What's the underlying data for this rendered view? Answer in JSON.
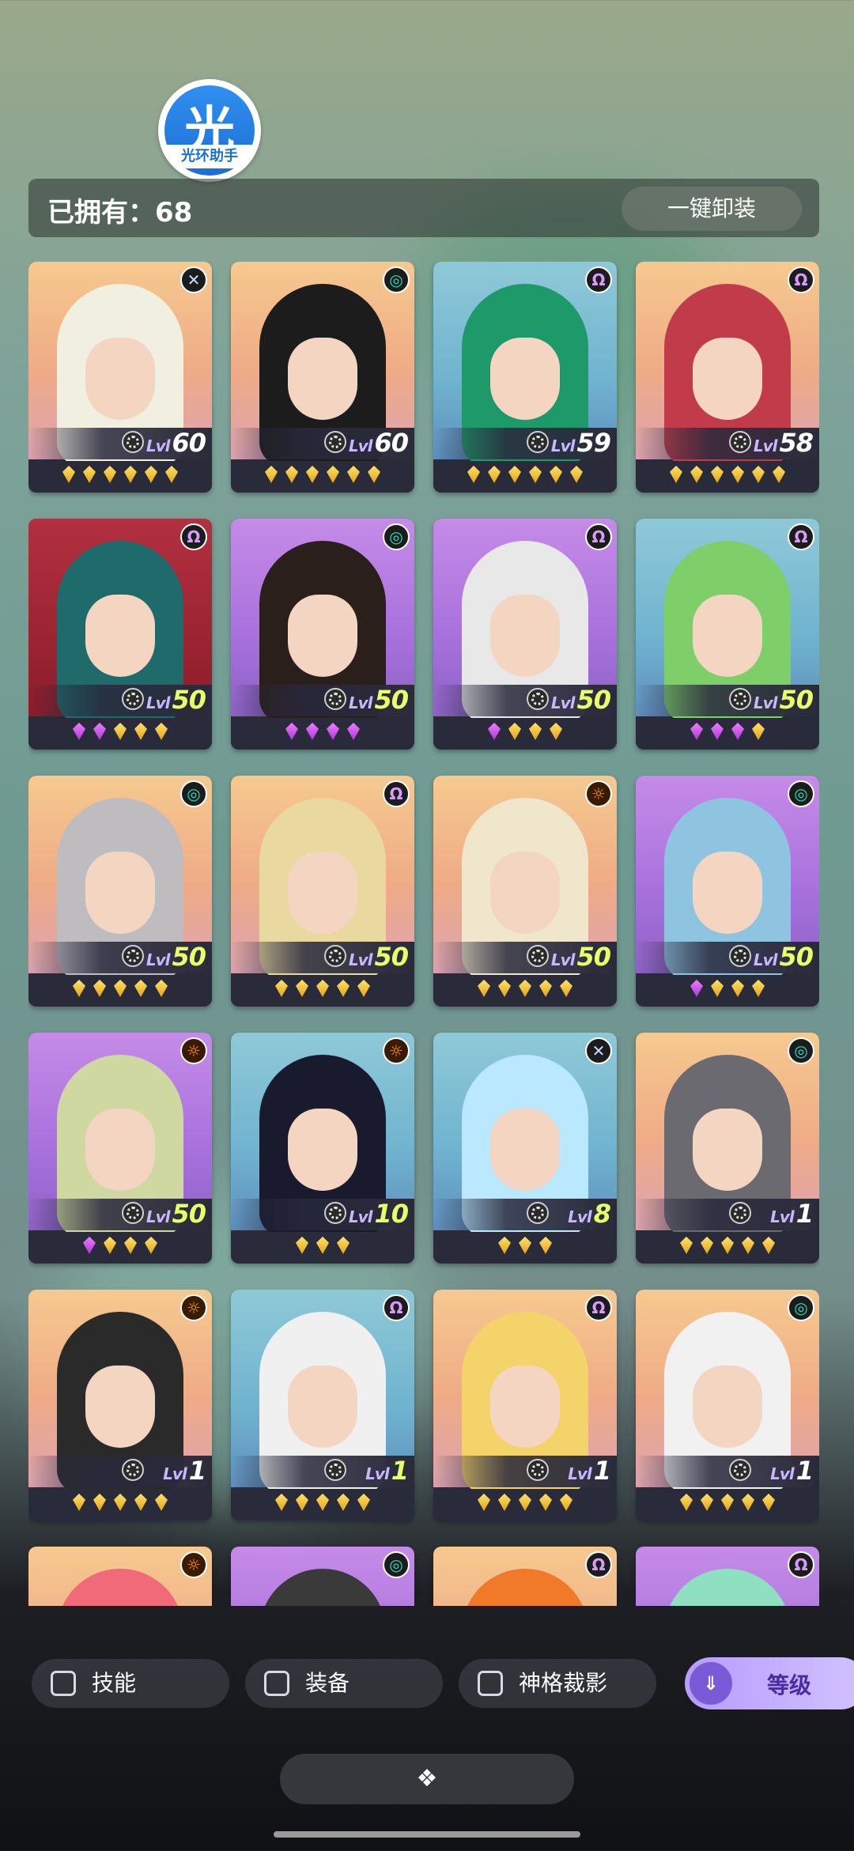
{
  "logo": {
    "glyph": "光",
    "caption": "光环助手"
  },
  "header": {
    "owned_label": "已拥有：68",
    "unequip_button": "一键卸装"
  },
  "heroes": [
    {
      "level": "60",
      "element": "x",
      "bg": "orange",
      "stars": [
        "g",
        "g",
        "g",
        "g",
        "g",
        "g"
      ]
    },
    {
      "level": "60",
      "element": "o",
      "bg": "orange",
      "stars": [
        "g",
        "g",
        "g",
        "g",
        "g",
        "g"
      ]
    },
    {
      "level": "59",
      "element": "w",
      "bg": "blue",
      "stars": [
        "g",
        "g",
        "g",
        "g",
        "g",
        "g"
      ]
    },
    {
      "level": "58",
      "element": "w",
      "bg": "orange",
      "stars": [
        "g",
        "g",
        "g",
        "g",
        "g",
        "g"
      ]
    },
    {
      "level": "50",
      "element": "w",
      "bg": "red",
      "stars": [
        "p",
        "p",
        "g",
        "g",
        "g"
      ]
    },
    {
      "level": "50",
      "element": "o",
      "bg": "purple",
      "stars": [
        "p",
        "p",
        "p",
        "p"
      ]
    },
    {
      "level": "50",
      "element": "w",
      "bg": "purple",
      "stars": [
        "p",
        "g",
        "g",
        "g"
      ]
    },
    {
      "level": "50",
      "element": "w",
      "bg": "blue",
      "stars": [
        "p",
        "p",
        "p",
        "g"
      ]
    },
    {
      "level": "50",
      "element": "o",
      "bg": "orange",
      "stars": [
        "g",
        "g",
        "g",
        "g",
        "g"
      ]
    },
    {
      "level": "50",
      "element": "w",
      "bg": "orange",
      "stars": [
        "g",
        "g",
        "g",
        "g",
        "g"
      ]
    },
    {
      "level": "50",
      "element": "s",
      "bg": "orange",
      "stars": [
        "g",
        "g",
        "g",
        "g",
        "g"
      ]
    },
    {
      "level": "50",
      "element": "o",
      "bg": "purple",
      "stars": [
        "p",
        "g",
        "g",
        "g"
      ]
    },
    {
      "level": "50",
      "element": "s",
      "bg": "purple",
      "stars": [
        "p",
        "g",
        "g",
        "g"
      ]
    },
    {
      "level": "10",
      "element": "s",
      "bg": "blue",
      "stars": [
        "g",
        "g",
        "g"
      ]
    },
    {
      "level": "8",
      "element": "x",
      "bg": "blue",
      "stars": [
        "g",
        "g",
        "g"
      ]
    },
    {
      "level": "1",
      "element": "o",
      "bg": "orange",
      "stars": [
        "g",
        "g",
        "g",
        "g",
        "g"
      ]
    },
    {
      "level": "1",
      "element": "s",
      "bg": "orange",
      "stars": [
        "g",
        "g",
        "g",
        "g",
        "g"
      ]
    },
    {
      "level": "1",
      "element": "w",
      "bg": "blue",
      "stars": [
        "g",
        "g",
        "g",
        "g",
        "g"
      ]
    },
    {
      "level": "1",
      "element": "w",
      "bg": "orange",
      "stars": [
        "g",
        "g",
        "g",
        "g",
        "g"
      ]
    },
    {
      "level": "1",
      "element": "o",
      "bg": "orange",
      "stars": [
        "g",
        "g",
        "g",
        "g",
        "g"
      ]
    },
    {
      "level": "",
      "element": "s",
      "bg": "orange",
      "stars": []
    },
    {
      "level": "",
      "element": "o",
      "bg": "purple",
      "stars": []
    },
    {
      "level": "",
      "element": "w",
      "bg": "orange",
      "stars": []
    },
    {
      "level": "",
      "element": "w",
      "bg": "purple",
      "stars": []
    }
  ],
  "level_prefix": "Lvl",
  "filters": {
    "skill": "技能",
    "equipment": "装备",
    "divine": "神格裁影",
    "sort": "等级"
  },
  "icons": {
    "element_x": "cross-element-icon",
    "element_o": "swirl-element-icon",
    "element_w": "omega-element-icon",
    "element_s": "sun-element-icon",
    "sort": "chevron-down-double-icon",
    "collapse": "diamond-cluster-icon"
  }
}
